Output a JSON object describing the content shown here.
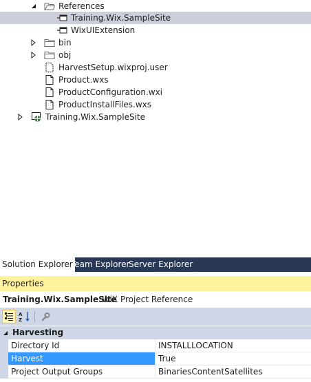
{
  "solution_tree": {
    "nodes": [
      {
        "label": "References",
        "icon": "folder-open-icon"
      },
      {
        "label": "Training.Wix.SampleSite",
        "icon": "project-reference-icon",
        "selected": true
      },
      {
        "label": "WixUIExtension",
        "icon": "extension-reference-icon"
      },
      {
        "label": "bin",
        "icon": "folder-icon"
      },
      {
        "label": "obj",
        "icon": "folder-icon"
      },
      {
        "label": "HarvestSetup.wixproj.user",
        "icon": "file-icon"
      },
      {
        "label": "Product.wxs",
        "icon": "file-icon"
      },
      {
        "label": "ProductConfiguration.wxi",
        "icon": "file-icon"
      },
      {
        "label": "ProductInstallFiles.wxs",
        "icon": "file-icon"
      },
      {
        "label": "Training.Wix.SampleSite",
        "icon": "web-project-icon"
      }
    ]
  },
  "tabs": [
    {
      "label": "Solution Explorer",
      "active": true
    },
    {
      "label": "Team Explorer",
      "active": false
    },
    {
      "label": "Server Explorer",
      "active": false
    }
  ],
  "properties": {
    "title": "Properties",
    "object_name": "Training.Wix.SampleSite",
    "object_type": "WiX Project Reference",
    "toolbar": {
      "categorized_icon": "categorized-icon",
      "alphabetical_icon": "alphabetical-sort-icon",
      "property_pages_icon": "wrench-icon"
    },
    "category": "Harvesting",
    "rows": [
      {
        "name": "Directory Id",
        "value": "INSTALLLOCATION"
      },
      {
        "name": "Harvest",
        "value": "True",
        "selected": true
      },
      {
        "name": "Project Output Groups",
        "value": "BinariesContentSatellites"
      }
    ]
  },
  "colors": {
    "selection_tree": "#cccedb",
    "selection_grid": "#3399ff",
    "tab_bar": "#293955",
    "properties_header": "#fff29d",
    "toolbar": "#cfd6e5"
  }
}
